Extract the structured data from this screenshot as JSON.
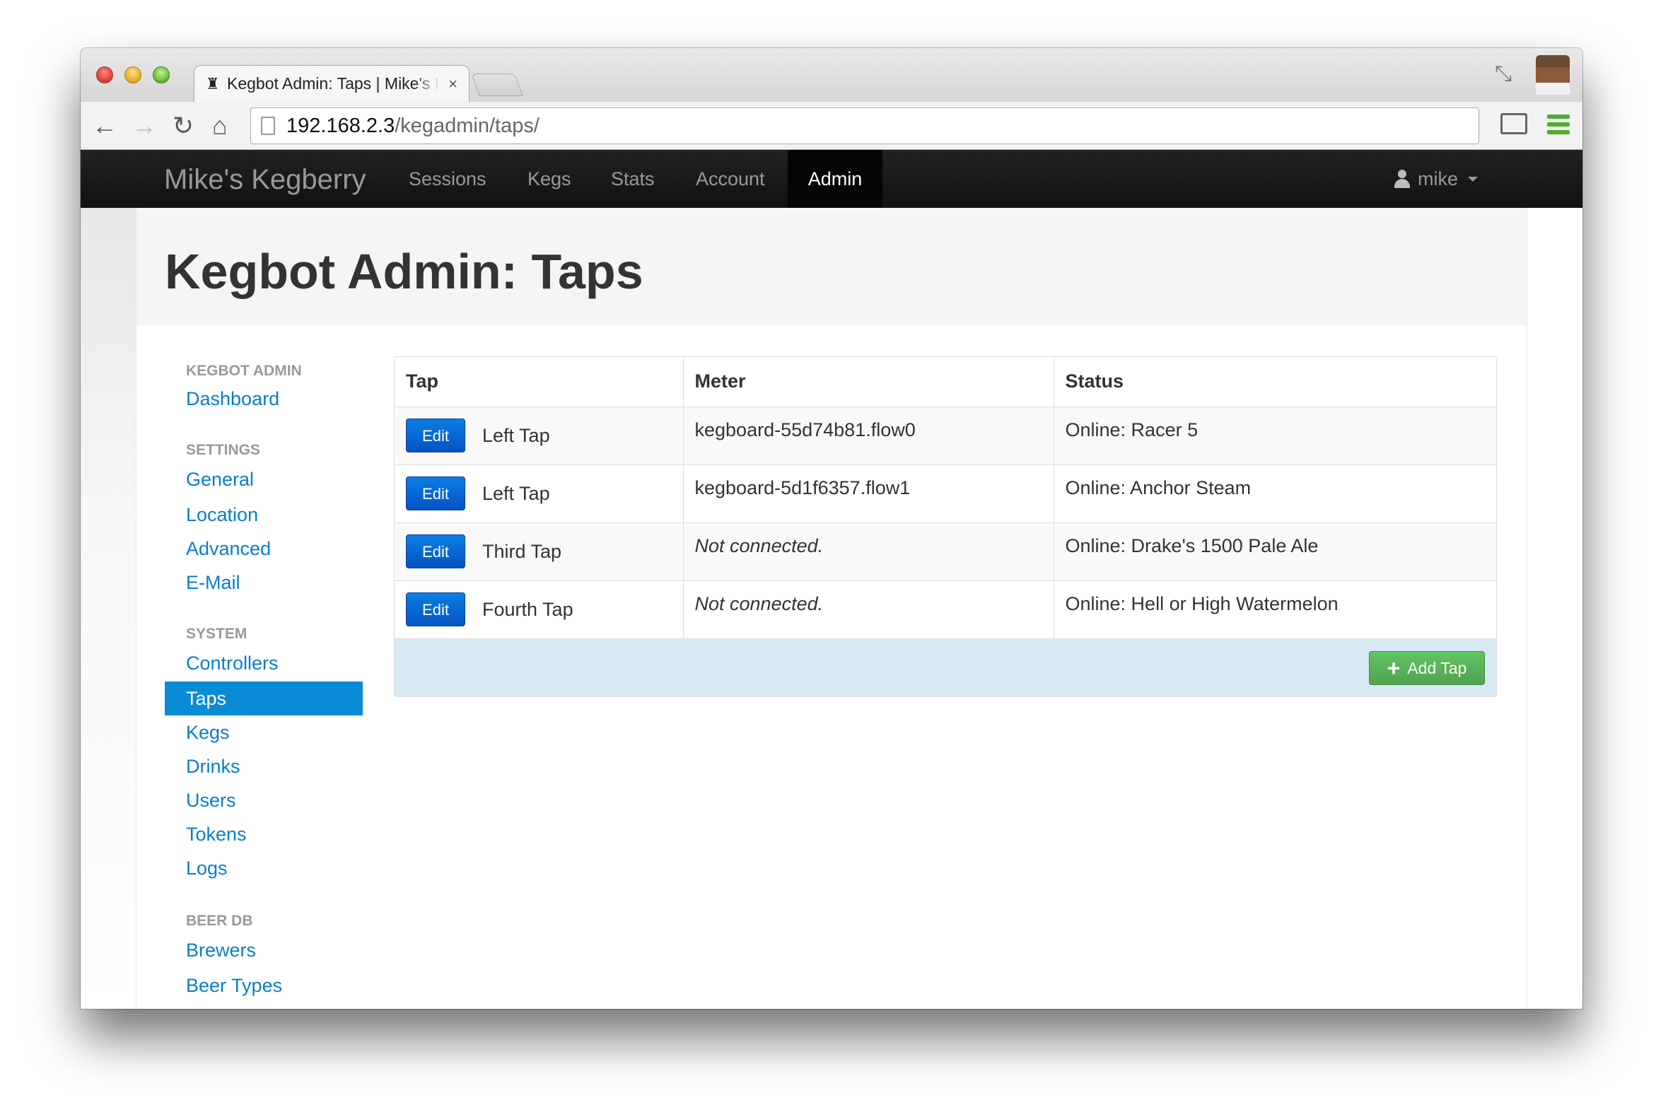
{
  "browser": {
    "tab_title": "Kegbot Admin: Taps | Mike's Kegberry",
    "tab_close": "×",
    "url_host": "192.168.2.3",
    "url_path": "/kegadmin/taps/"
  },
  "navbar": {
    "brand": "Mike's Kegberry",
    "items": [
      "Sessions",
      "Kegs",
      "Stats",
      "Account",
      "Admin"
    ],
    "active": "Admin",
    "user": "mike"
  },
  "page": {
    "title": "Kegbot Admin: Taps"
  },
  "sidebar": {
    "sections": [
      {
        "header": "Kegbot Admin",
        "links": [
          "Dashboard"
        ]
      },
      {
        "header": "Settings",
        "links": [
          "General",
          "Location",
          "Advanced",
          "E-Mail"
        ]
      },
      {
        "header": "System",
        "links": [
          "Controllers",
          "Taps",
          "Kegs",
          "Drinks",
          "Users",
          "Tokens",
          "Logs"
        ]
      },
      {
        "header": "Beer DB",
        "links": [
          "Brewers",
          "Beer Types"
        ]
      }
    ],
    "active": "Taps"
  },
  "table": {
    "headers": [
      "Tap",
      "Meter",
      "Status"
    ],
    "edit_label": "Edit",
    "rows": [
      {
        "tap": "Left Tap",
        "meter": "kegboard-55d74b81.flow0",
        "meter_connected": true,
        "status": "Online: Racer 5"
      },
      {
        "tap": "Left Tap",
        "meter": "kegboard-5d1f6357.flow1",
        "meter_connected": true,
        "status": "Online: Anchor Steam"
      },
      {
        "tap": "Third Tap",
        "meter": "Not connected.",
        "meter_connected": false,
        "status": "Online: Drake's 1500 Pale Ale"
      },
      {
        "tap": "Fourth Tap",
        "meter": "Not connected.",
        "meter_connected": false,
        "status": "Online: Hell or High Watermelon"
      }
    ],
    "add_label": "Add Tap"
  },
  "colors": {
    "navbar": "#111111",
    "link": "#0a7dcc",
    "active_sidebar": "#0a8bd6",
    "edit_button": "#0a6ed8",
    "add_button": "#5bb75b",
    "table_footer": "#d8ebf5"
  }
}
